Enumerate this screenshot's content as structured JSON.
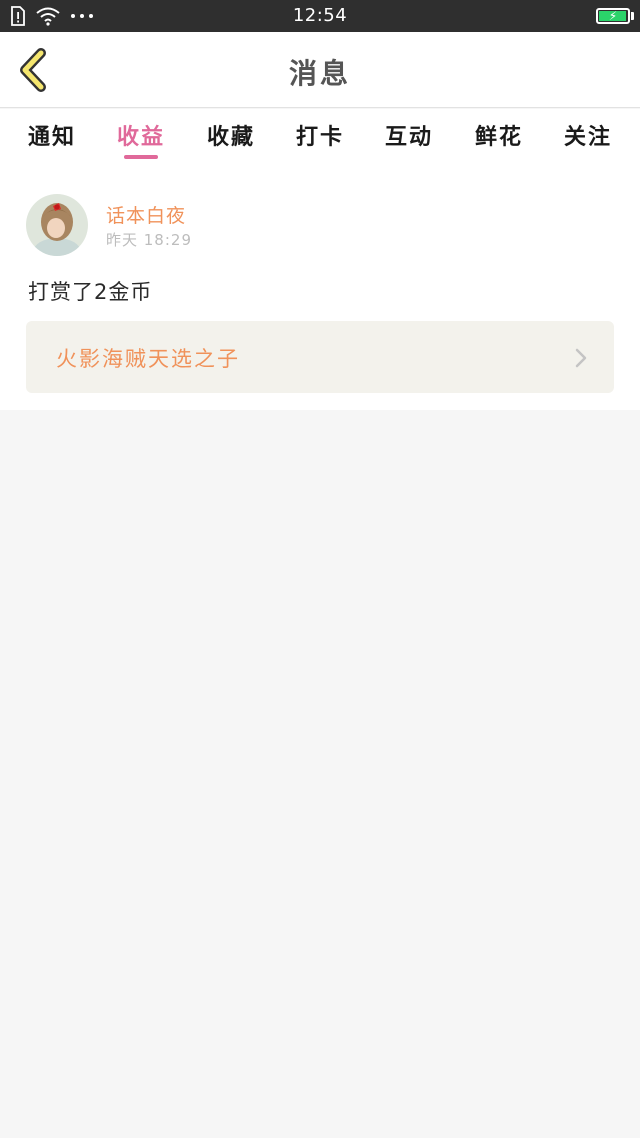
{
  "status_bar": {
    "time": "12:54",
    "icons": [
      "sim-alert-icon",
      "wifi-icon",
      "more-dots-icon"
    ],
    "battery_level": 0.95,
    "battery_state": "charging"
  },
  "header": {
    "title": "消息",
    "back_icon": "chevron-left-icon",
    "accent_color": "#f5e66e"
  },
  "tabs": [
    {
      "label": "通知",
      "active": false
    },
    {
      "label": "收益",
      "active": true
    },
    {
      "label": "收藏",
      "active": false
    },
    {
      "label": "打卡",
      "active": false
    },
    {
      "label": "互动",
      "active": false
    },
    {
      "label": "鲜花",
      "active": false
    },
    {
      "label": "关注",
      "active": false
    }
  ],
  "colors": {
    "active_tab": "#e0699a",
    "name": "#f0925a",
    "background": "#f6f6f6"
  },
  "message": {
    "sender": "话本白夜",
    "time": "昨天 18:29",
    "text": "打赏了2金币",
    "work_title": "火影海贼天选之子",
    "link_icon": "chevron-right-icon"
  }
}
